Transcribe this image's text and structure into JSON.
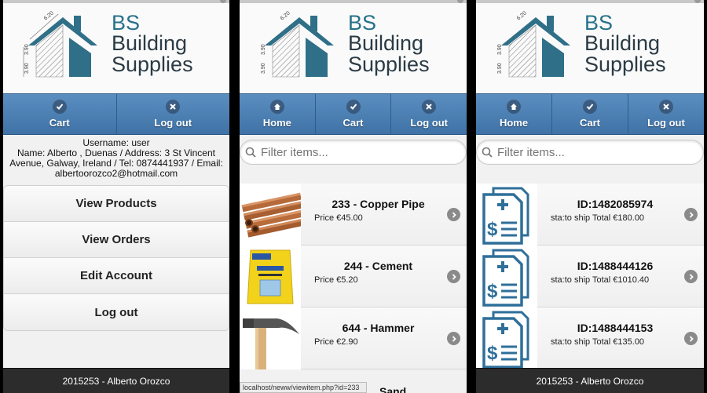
{
  "brand": {
    "line1": "BS",
    "line2": "Building",
    "line3": "Supplies",
    "dims": [
      "6.20",
      "3.90",
      "3.90"
    ]
  },
  "screen1": {
    "nav": [
      {
        "label": "Cart",
        "icon": "check-icon"
      },
      {
        "label": "Log out",
        "icon": "close-icon"
      }
    ],
    "user": {
      "username": "Username: user",
      "details": "Name: Alberto , Duenas / Address: 3 St Vincent Avenue, Galway, Ireland / Tel: 0874441937 / Email: albertoorozco2@hotmail.com"
    },
    "menu": [
      "View Products",
      "View Orders",
      "Edit Account",
      "Log out"
    ],
    "footer": "2015253 - Alberto Orozco"
  },
  "screen2": {
    "nav": [
      {
        "label": "Home",
        "icon": "home-icon"
      },
      {
        "label": "Cart",
        "icon": "check-icon"
      },
      {
        "label": "Log out",
        "icon": "close-icon"
      }
    ],
    "filter_placeholder": "Filter items...",
    "items": [
      {
        "title": "233 - Copper Pipe",
        "price": "Price €45.00",
        "image": "copper-pipes"
      },
      {
        "title": "244 - Cement",
        "price": "Price €5.20",
        "image": "cement-bag"
      },
      {
        "title": "644 - Hammer",
        "price": "Price €2.90",
        "image": "hammer"
      }
    ],
    "partial_item": "Sand",
    "status_url": "localhost/neww/viewitem.php?id=233"
  },
  "screen3": {
    "nav": [
      {
        "label": "Home",
        "icon": "home-icon"
      },
      {
        "label": "Cart",
        "icon": "check-icon"
      },
      {
        "label": "Log out",
        "icon": "close-icon"
      }
    ],
    "filter_placeholder": "Filter items...",
    "orders": [
      {
        "id": "ID:1482085974",
        "status": "sta:to ship Total €180.00"
      },
      {
        "id": "ID:1488444126",
        "status": "sta:to ship Total €1010.40"
      },
      {
        "id": "ID:1488444153",
        "status": "sta:to ship Total €135.00"
      }
    ],
    "footer": "2015253 - Alberto Orozco"
  },
  "colors": {
    "brand_blue": "#27718a",
    "nav_blue": "#4a7fb3",
    "icon_blue": "#2f6f9a"
  }
}
